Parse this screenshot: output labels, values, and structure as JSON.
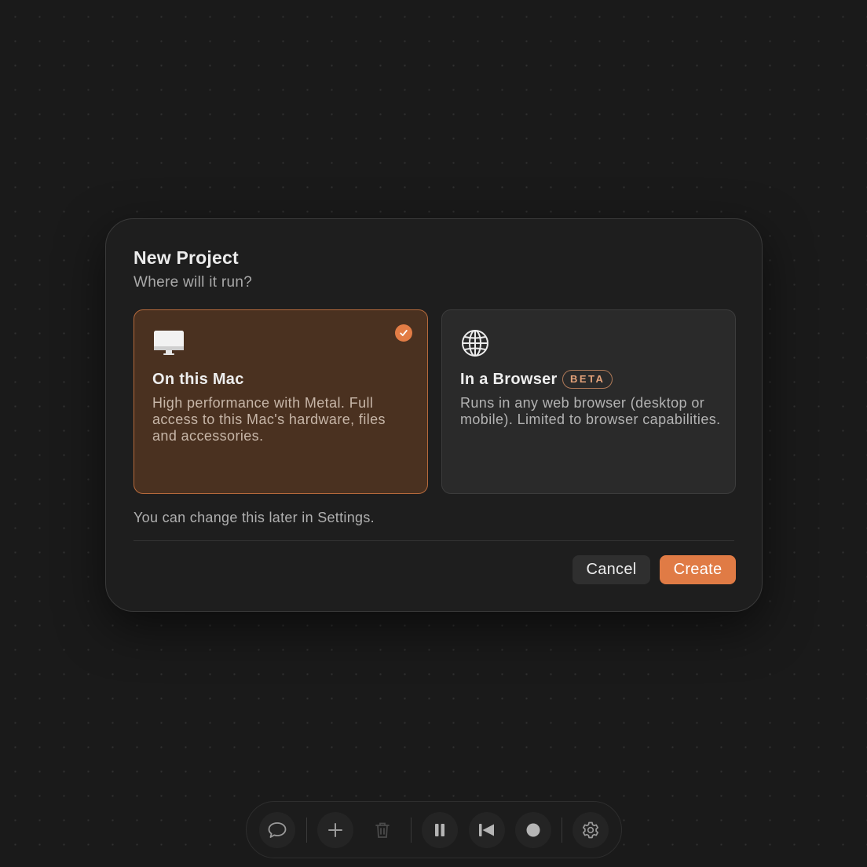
{
  "dialog": {
    "title": "New Project",
    "subtitle": "Where will it run?",
    "options": [
      {
        "id": "mac",
        "icon": "desktop-computer-icon",
        "title": "On this Mac",
        "description": "High performance with Metal. Full access to this Mac's hardware, files and accessories.",
        "selected": true
      },
      {
        "id": "browser",
        "icon": "globe-icon",
        "title": "In a Browser",
        "badge": "BETA",
        "description": "Runs in any web browser (desktop or mobile). Limited to browser capabilities.",
        "selected": false
      }
    ],
    "note": "You can change this later in Settings.",
    "cancel_label": "Cancel",
    "create_label": "Create"
  },
  "toolbar": {
    "buttons": [
      "chat-bubble-icon",
      "plus-icon",
      "trash-icon",
      "pause-icon",
      "skip-back-icon",
      "record-icon",
      "gear-icon"
    ]
  },
  "colors": {
    "accent": "#e07b45",
    "selected_card_bg": "#4a3120",
    "background": "#1a1a1a"
  }
}
